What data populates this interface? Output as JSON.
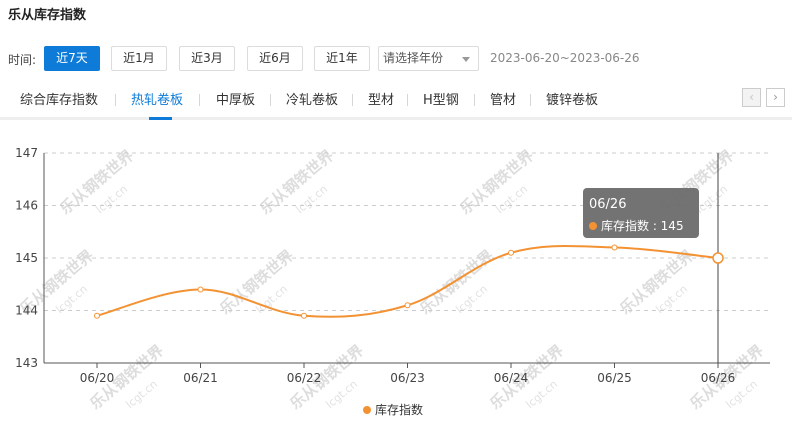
{
  "page": {
    "title": "乐从库存指数"
  },
  "filters": {
    "label": "时间:",
    "ranges": [
      "近7天",
      "近1月",
      "近3月",
      "近6月",
      "近1年"
    ],
    "active_range": 0,
    "year_placeholder": "请选择年份",
    "date_range": "2023-06-20~2023-06-26"
  },
  "tabs": {
    "items": [
      "综合库存指数",
      "热轧卷板",
      "中厚板",
      "冷轧卷板",
      "型材",
      "H型钢",
      "管材",
      "镀锌卷板"
    ],
    "active": 1,
    "prev_icon": "chevron-left-icon",
    "next_icon": "chevron-right-icon"
  },
  "watermark": {
    "main": "乐从钢铁世界",
    "sub": "lcgt.cn"
  },
  "chart_data": {
    "type": "line",
    "categories": [
      "06/20",
      "06/21",
      "06/22",
      "06/23",
      "06/24",
      "06/25",
      "06/26"
    ],
    "series": [
      {
        "name": "库存指数",
        "values": [
          143.9,
          144.4,
          143.9,
          144.1,
          145.1,
          145.2,
          145.0
        ],
        "color": "#f39233"
      }
    ],
    "ylim": [
      143,
      147
    ],
    "yticks": [
      143,
      144,
      145,
      146,
      147
    ],
    "grid": true,
    "legend_position": "bottom-center",
    "tooltip": {
      "title": "06/26",
      "label": "库存指数",
      "value": "145",
      "index": 6
    },
    "colors": {
      "axis": "#555555",
      "grid": "#cccccc",
      "tooltip_bg": "#6b6b6b"
    }
  }
}
